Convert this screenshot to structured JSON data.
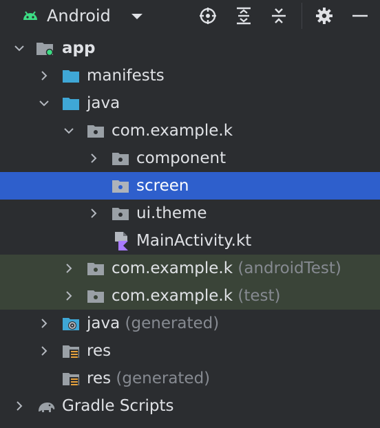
{
  "toolbar": {
    "view_name": "Android",
    "icons": [
      "android-icon",
      "dropdown-icon",
      "locate-icon",
      "expand-all-icon",
      "collapse-all-icon",
      "settings-icon",
      "hide-icon"
    ]
  },
  "colors": {
    "selection": "#2e5fcc",
    "test_rows": "#3a4438",
    "folder": "#3fa7d6"
  },
  "tree": {
    "app": "app",
    "manifests": "manifests",
    "java": "java",
    "pkg_main": "com.example.k",
    "component": "component",
    "screen": "screen",
    "ui_theme": "ui.theme",
    "main_activity": "MainActivity.kt",
    "pkg_android_test": "com.example.k",
    "pkg_android_test_suffix": "(androidTest)",
    "pkg_test": "com.example.k",
    "pkg_test_suffix": "(test)",
    "java_generated": "java",
    "java_generated_suffix": "(generated)",
    "res": "res",
    "res_generated": "res",
    "res_generated_suffix": "(generated)",
    "gradle_scripts": "Gradle Scripts"
  }
}
